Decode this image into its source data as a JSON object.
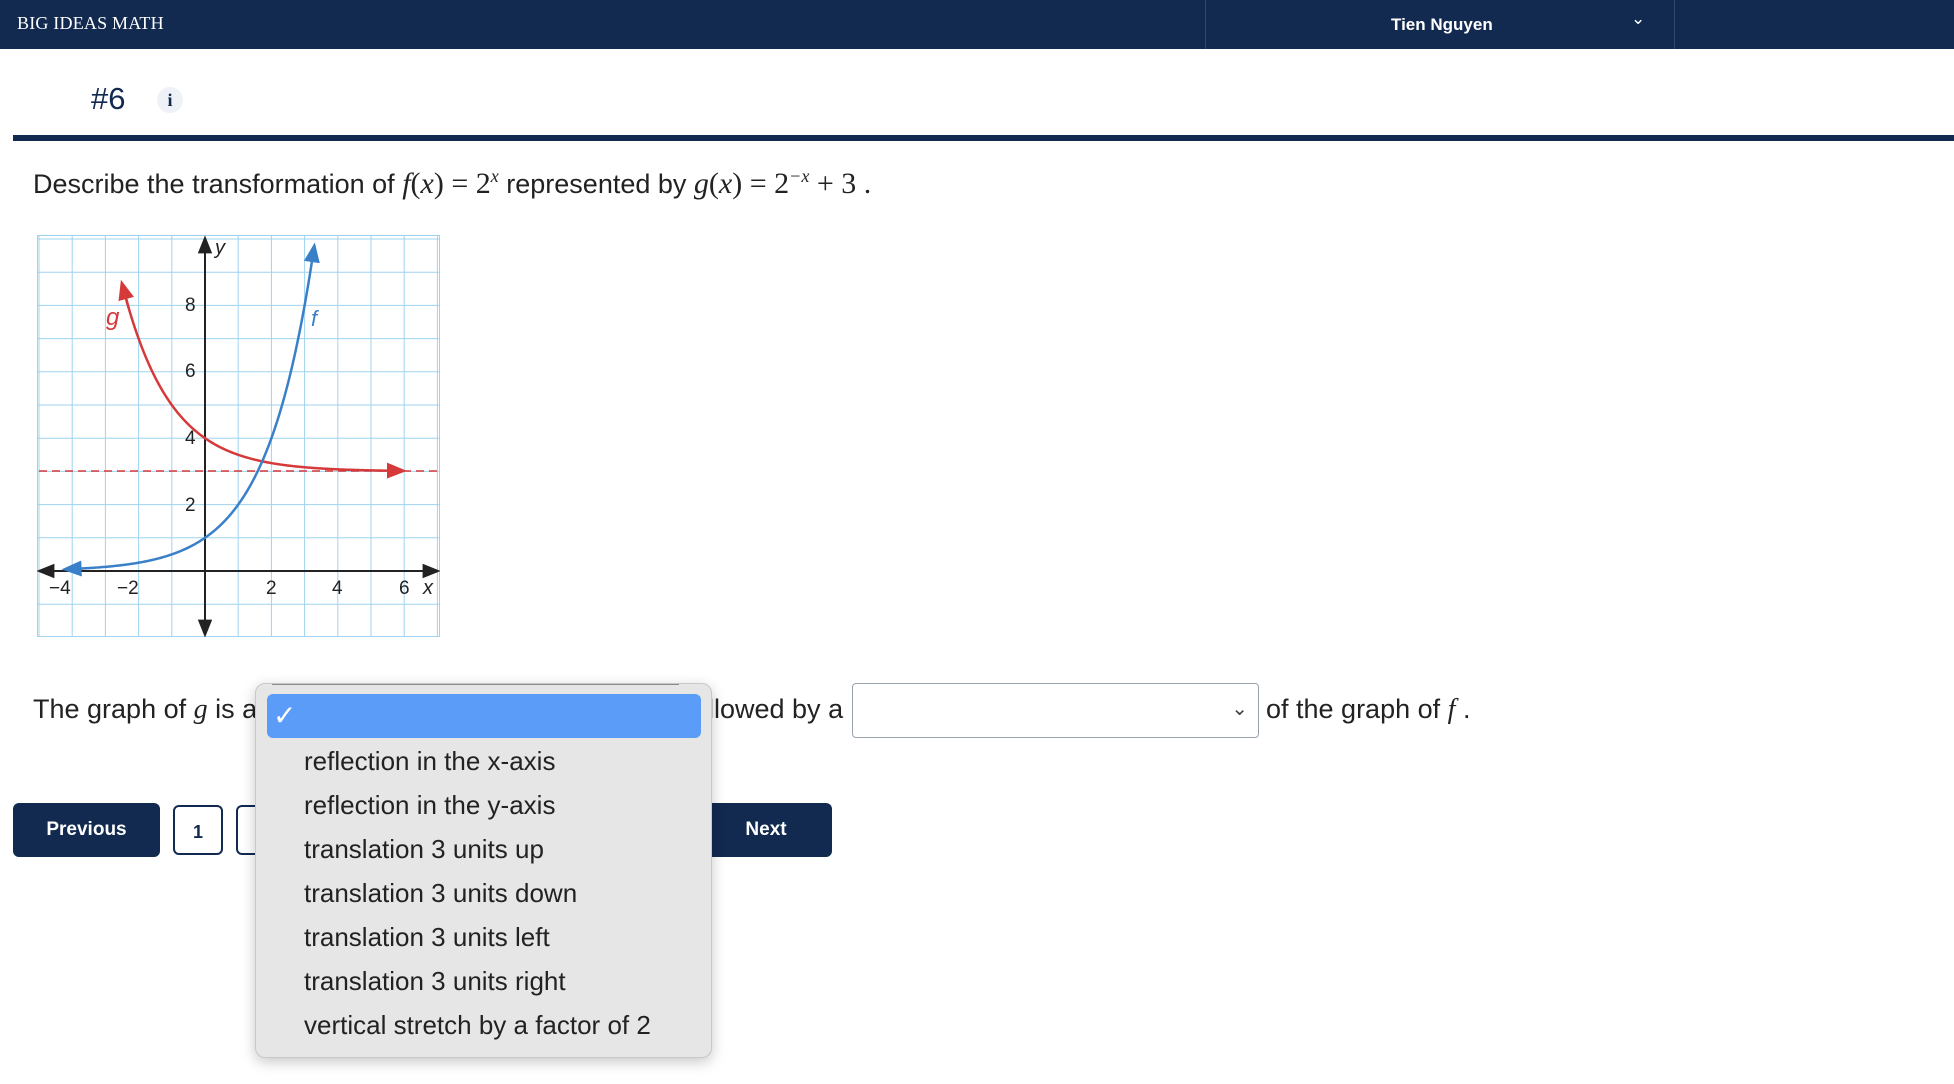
{
  "header": {
    "brand": "BIG IDEAS MATH",
    "user_name": "Tien Nguyen",
    "user_chevron": "chevron-down-icon"
  },
  "question": {
    "number": "#6",
    "info_icon": "i",
    "prompt_prefix": "Describe the transformation of",
    "f_name": "f",
    "f_var": "x",
    "f_base": "2",
    "f_exp": "x",
    "prompt_middle": "represented by",
    "g_name": "g",
    "g_var": "x",
    "g_base": "2",
    "g_exp": "−x",
    "g_tail": "+ 3",
    "period": "."
  },
  "graph": {
    "y_label": "y",
    "x_label": "x",
    "x_ticks": [
      "−4",
      "−2",
      "2",
      "4",
      "6"
    ],
    "y_ticks": [
      "2",
      "4",
      "6",
      "8"
    ],
    "curve_f_label": "f",
    "curve_g_label": "g",
    "colors": {
      "f": "#3a80c8",
      "g": "#d6393a",
      "grid": "#9fd3ef",
      "asymptote": "#d6393a"
    }
  },
  "answer": {
    "lead_text": "The graph of",
    "lead_var": "g",
    "lead_is": "is a",
    "hidden_tail": "llowed by a",
    "end_text": "of the graph of",
    "end_var": "f",
    "end_period": ".",
    "select2_value": ""
  },
  "dropdown": {
    "selected_label": "",
    "options": [
      "reflection in the x-axis",
      "reflection in the y-axis",
      "translation 3 units up",
      "translation 3 units down",
      "translation 3 units left",
      "translation 3 units right",
      "vertical stretch by a factor of 2"
    ]
  },
  "nav": {
    "previous": "Previous",
    "page_1": "1",
    "next": "Next"
  }
}
